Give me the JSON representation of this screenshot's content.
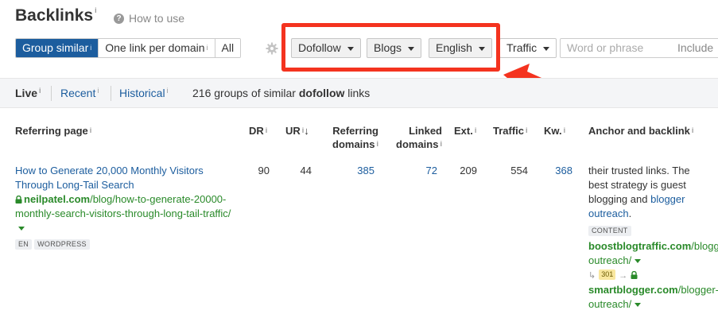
{
  "header": {
    "title": "Backlinks",
    "title_sup": "i",
    "how_to_use": "How to use"
  },
  "toolbar": {
    "group_options": [
      {
        "label": "Group similar",
        "sup": "i",
        "active": true
      },
      {
        "label": "One link per domain",
        "sup": "i",
        "active": false
      },
      {
        "label": "All",
        "sup": "",
        "active": false
      }
    ],
    "filters": {
      "dofollow": "Dofollow",
      "blogs": "Blogs",
      "language": "English",
      "traffic": "Traffic"
    },
    "search_placeholder": "Word or phrase",
    "include_label": "Include"
  },
  "subbar": {
    "live": "Live",
    "recent": "Recent",
    "historical": "Historical",
    "sup": "i",
    "summary_prefix": "216 groups of similar",
    "summary_bold": "dofollow",
    "summary_suffix": "links"
  },
  "table": {
    "headers": {
      "referring_page": "Referring page",
      "dr": "DR",
      "ur": "UR",
      "ur_sort": "↓",
      "ref_domains_1": "Referring",
      "ref_domains_2": "domains",
      "linked_1": "Linked",
      "linked_2": "domains",
      "ext": "Ext.",
      "traffic": "Traffic",
      "kw": "Kw.",
      "anchor": "Anchor and backlink",
      "sup": "i"
    },
    "row": {
      "title": "How to Generate 20,000 Monthly Visitors Through Long-Tail Search",
      "domain": "neilpatel.com",
      "path": "/blog/how-to-generate-20000-monthly-search-visitors-through-long-tail-traffic/",
      "tags": [
        "EN",
        "WORDPRESS"
      ],
      "dr": "90",
      "ur": "44",
      "ref_domains": "385",
      "linked_domains": "72",
      "ext": "209",
      "traffic": "554",
      "kw": "368",
      "anchor_text": "their trusted links. The best strategy is guest blogging and",
      "anchor_link": "blogger outreach",
      "anchor_end": ".",
      "content_tag": "CONTENT",
      "backlink_domain": "boostblogtraffic.com",
      "backlink_path": "/blogger-outreach/",
      "redirect_code": "301",
      "redirect_domain": "smartblogger.com",
      "redirect_path": "/blogger-outreach/"
    }
  },
  "colors": {
    "accent": "#1c5d9e",
    "annotation": "#f4331f",
    "url_green": "#2a8a2a"
  },
  "icons": {
    "help": "question-circle-icon",
    "settings": "gear-icon",
    "secure": "lock-icon"
  }
}
